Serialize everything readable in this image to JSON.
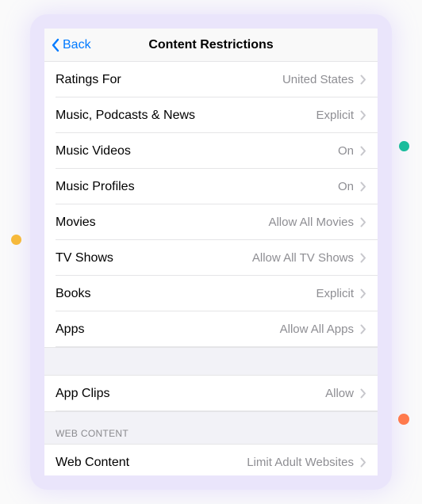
{
  "nav": {
    "back_label": "Back",
    "title": "Content Restrictions"
  },
  "rows": [
    {
      "label": "Ratings For",
      "value": "United States"
    },
    {
      "label": "Music, Podcasts & News",
      "value": "Explicit"
    },
    {
      "label": "Music Videos",
      "value": "On"
    },
    {
      "label": "Music Profiles",
      "value": "On"
    },
    {
      "label": "Movies",
      "value": "Allow All Movies"
    },
    {
      "label": "TV Shows",
      "value": "Allow All TV Shows"
    },
    {
      "label": "Books",
      "value": "Explicit"
    },
    {
      "label": "Apps",
      "value": "Allow All Apps"
    }
  ],
  "app_clips": {
    "label": "App Clips",
    "value": "Allow"
  },
  "web_section": {
    "heading": "WEB CONTENT"
  },
  "web_row": {
    "label": "Web Content",
    "value": "Limit Adult Websites"
  }
}
